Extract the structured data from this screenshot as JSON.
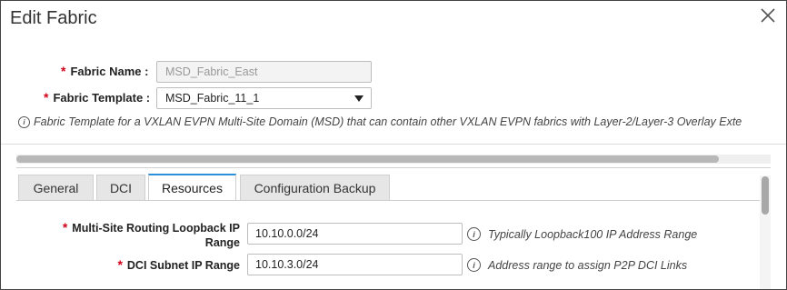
{
  "dialog": {
    "title": "Edit Fabric",
    "close_icon": "close-icon"
  },
  "form": {
    "required_mark": "*",
    "fabric_name": {
      "label": "Fabric Name :",
      "value": "MSD_Fabric_East"
    },
    "fabric_template": {
      "label": "Fabric Template :",
      "value": "MSD_Fabric_11_1"
    },
    "info_text": "Fabric Template for a VXLAN EVPN Multi-Site Domain (MSD) that can contain other VXLAN EVPN fabrics with Layer-2/Layer-3 Overlay Exte"
  },
  "tabs": [
    {
      "label": "General",
      "active": false
    },
    {
      "label": "DCI",
      "active": false
    },
    {
      "label": "Resources",
      "active": true
    },
    {
      "label": "Configuration Backup",
      "active": false
    }
  ],
  "resources": {
    "loopback_range": {
      "label_line1": "Multi-Site Routing Loopback IP",
      "label_line2": "Range",
      "value": "10.10.0.0/24",
      "hint": "Typically Loopback100 IP Address Range"
    },
    "dci_subnet": {
      "label": "DCI Subnet IP Range",
      "value": "10.10.3.0/24",
      "hint": "Address range to assign P2P DCI Links"
    }
  },
  "colors": {
    "required": "#d0021b",
    "active_tab_accent": "#2d8fd5"
  }
}
